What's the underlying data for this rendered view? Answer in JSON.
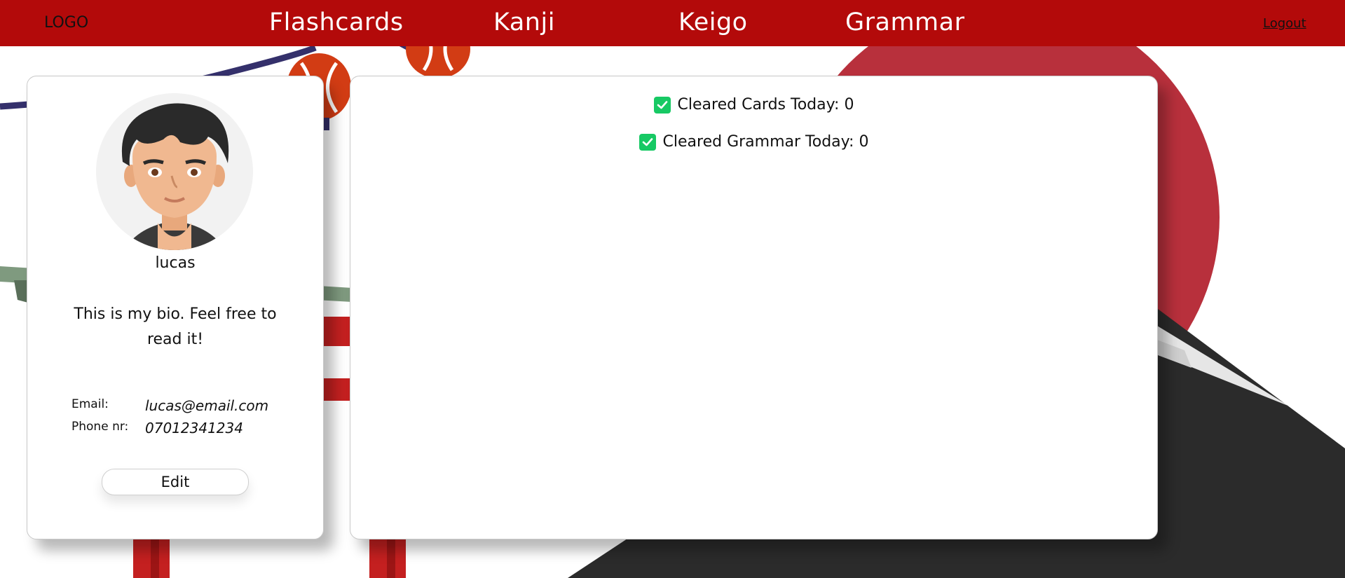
{
  "nav": {
    "logo": "LOGO",
    "links": [
      "Flashcards",
      "Kanji",
      "Keigo",
      "Grammar"
    ],
    "logout": "Logout"
  },
  "profile": {
    "username": "lucas",
    "bio": "This is my bio. Feel free to read it!",
    "email_label": "Email:",
    "email": "lucas@email.com",
    "phone_label": "Phone nr:",
    "phone": "07012341234",
    "edit_label": "Edit"
  },
  "stats": [
    {
      "label": "Cleared Cards Today: 0"
    },
    {
      "label": "Cleared Grammar Today: 0"
    }
  ],
  "colors": {
    "nav_bg": "#b30a0a",
    "check": "#17c964",
    "sun": "#b8303c",
    "mountain": "#2b2b2b"
  }
}
